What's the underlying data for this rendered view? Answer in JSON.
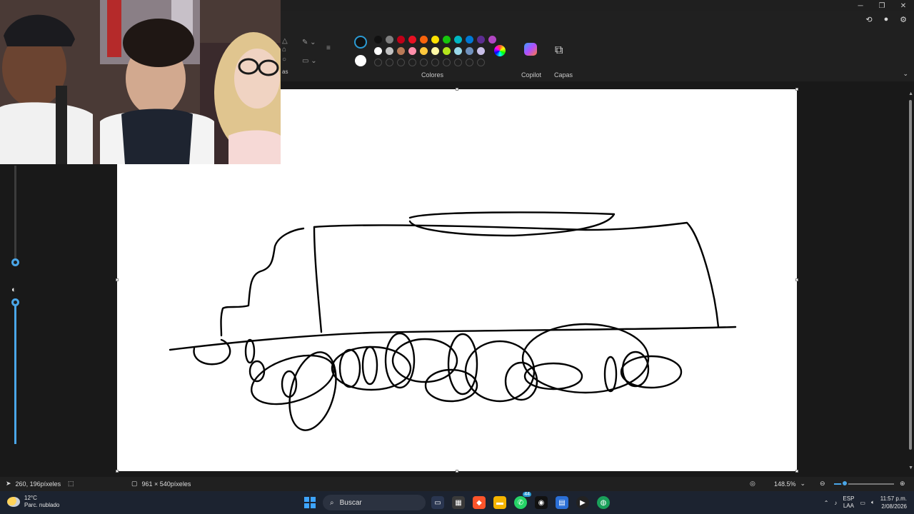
{
  "toolbar": {
    "colors_label": "Colores",
    "copilot_label": "Copilot",
    "layers_label": "Capas",
    "left_group_fragment": "as",
    "palette_row1": [
      "#111111",
      "#7f7f7f",
      "#c00018",
      "#e81123",
      "#f7630c",
      "#fce100",
      "#16c60c",
      "#00b7c3",
      "#0078d4",
      "#5c2d91",
      "#b146c2"
    ],
    "palette_row2": [
      "#ffffff",
      "#c3c3c3",
      "#b97a57",
      "#ff8fab",
      "#ffc83d",
      "#fff9a6",
      "#b5e61d",
      "#99d9ea",
      "#7092be",
      "#c8bfe7"
    ]
  },
  "status": {
    "cursor_position": "260, 196píxeles",
    "canvas_size": "961 × 540píxeles",
    "zoom": "148.5%"
  },
  "taskbar": {
    "temperature": "12°C",
    "weather_desc": "Parc. nublado",
    "search_placeholder": "Buscar",
    "whatsapp_badge": "44",
    "lang_line1": "ESP",
    "lang_line2": "LAA",
    "time": "11:57 p.m.",
    "date": "2/08/2026"
  },
  "icons": {
    "minimize": "minimize-icon",
    "restore": "restore-icon",
    "close": "close-icon"
  }
}
